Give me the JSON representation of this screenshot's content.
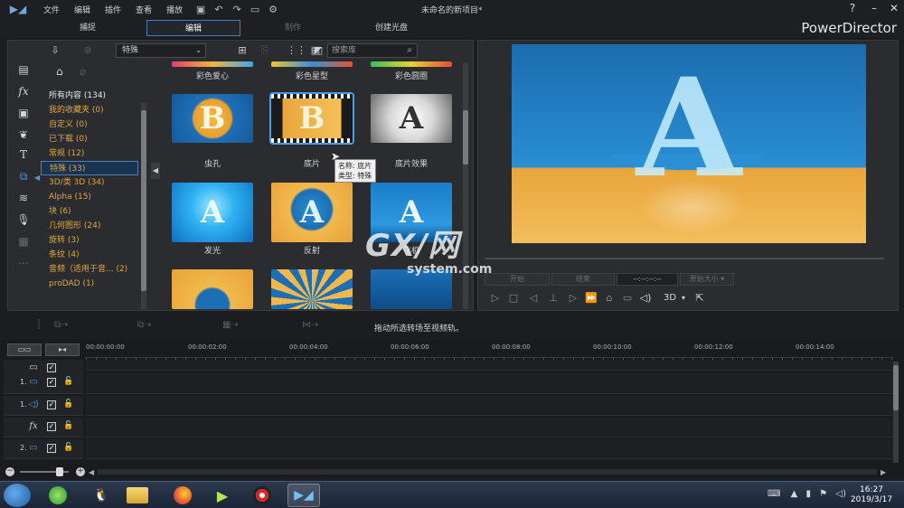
{
  "menubar": {
    "items": [
      "文件",
      "编辑",
      "插件",
      "查看",
      "播放"
    ],
    "window_title": "未命名的新项目*",
    "help": "?"
  },
  "tabs": [
    {
      "label": "捕捉",
      "state": "normal"
    },
    {
      "label": "编辑",
      "state": "active"
    },
    {
      "label": "制作",
      "state": "disabled"
    },
    {
      "label": "创建光盘",
      "state": "normal"
    }
  ],
  "brand": "PowerDirector",
  "library": {
    "dropdown_value": "特殊",
    "search_placeholder": "搜索库",
    "categories": [
      {
        "label": "所有内容 (134)",
        "color": "white"
      },
      {
        "label": "我的收藏夹 (0)",
        "color": "orange"
      },
      {
        "label": "自定义 (0)",
        "color": "orange"
      },
      {
        "label": "已下载 (0)",
        "color": "orange"
      },
      {
        "label": "常规 (12)",
        "color": "orange"
      },
      {
        "label": "特殊 (33)",
        "color": "orange",
        "selected": true
      },
      {
        "label": "3D/类 3D (34)",
        "color": "orange"
      },
      {
        "label": "Alpha (15)",
        "color": "orange"
      },
      {
        "label": "块 (6)",
        "color": "orange"
      },
      {
        "label": "几何图形 (24)",
        "color": "orange"
      },
      {
        "label": "旋转 (3)",
        "color": "orange"
      },
      {
        "label": "条纹 (4)",
        "color": "orange"
      },
      {
        "label": "音频（适用于音... (2)",
        "color": "orange"
      },
      {
        "label": "proDAD (1)",
        "color": "orange"
      }
    ],
    "top_labels": [
      "彩色爱心",
      "彩色星型",
      "彩色圆圈"
    ],
    "tiles": [
      {
        "label": "虫孔",
        "letter": "B"
      },
      {
        "label": "底片",
        "letter": "B",
        "selected": true
      },
      {
        "label": "底片效果",
        "letter": "A"
      },
      {
        "label": "发光",
        "letter": "A"
      },
      {
        "label": "反射",
        "letter": "A"
      },
      {
        "label": "飞机",
        "letter": "A"
      }
    ],
    "tooltip": {
      "name": "名称: 底片",
      "type": "类型: 特殊"
    }
  },
  "preview": {
    "letter": "A",
    "mark_in": "开始",
    "mark_out": "结束",
    "timecode": "--:--:--:--",
    "size": "原始大小",
    "mode_3d": "3D"
  },
  "status_text": "拖动所选转场至视频轨。",
  "timeline": {
    "ticks": [
      "00:00:00:00",
      "00:00:02:00",
      "00:00:04:00",
      "00:00:06:00",
      "00:00:08:00",
      "00:00:10:00",
      "00:00:12:00",
      "00:00:14:00"
    ],
    "tracks": [
      {
        "label": "",
        "icon": "video"
      },
      {
        "label": "1.",
        "icon": "video"
      },
      {
        "label": "1.",
        "icon": "audio"
      },
      {
        "label": "",
        "icon": "fx"
      },
      {
        "label": "2.",
        "icon": "video"
      }
    ]
  },
  "watermark": {
    "main": "GX/网",
    "sub": "system.com"
  },
  "taskbar": {
    "time": "16:27",
    "date": "2019/3/17"
  }
}
